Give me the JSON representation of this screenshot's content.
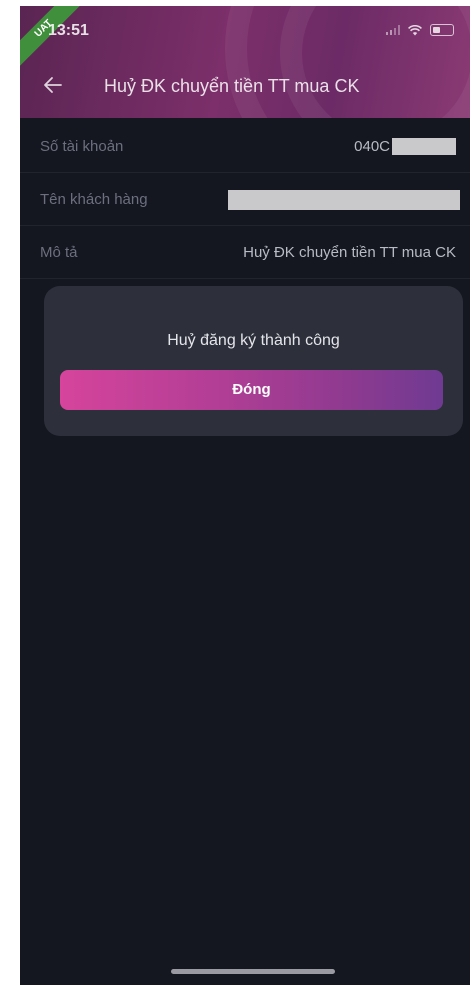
{
  "status_bar": {
    "badge": "UAT",
    "time": "13:51"
  },
  "header": {
    "title": "Huỷ ĐK chuyển tiền TT mua CK"
  },
  "details": [
    {
      "label": "Số tài khoản",
      "value": "040C"
    },
    {
      "label": "Tên khách hàng",
      "value": ""
    },
    {
      "label": "Mô tả",
      "value": "Huỷ ĐK chuyển tiền TT mua CK"
    }
  ],
  "dialog": {
    "message": "Huỷ đăng ký thành công",
    "button_label": "Đóng"
  },
  "colors": {
    "background": "#141620",
    "dialog": "#2d2f3a",
    "accent_start": "#d6449c",
    "accent_end": "#6f3a92"
  }
}
